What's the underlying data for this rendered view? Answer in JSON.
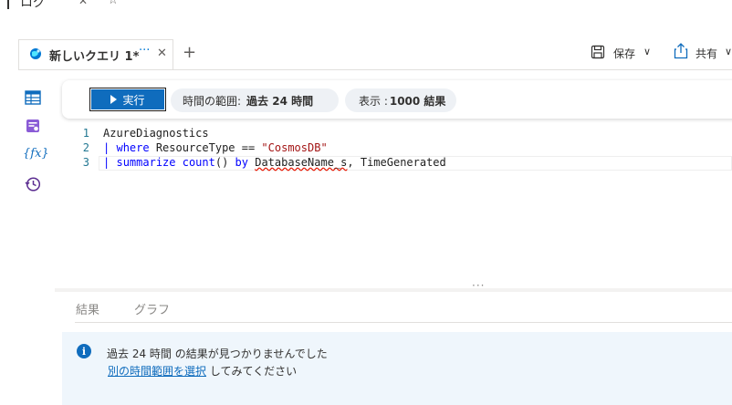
{
  "top": {
    "title": "ログ",
    "close_glyph": "✕",
    "star_glyph": "☆"
  },
  "tab": {
    "label": "新しいクエリ 1*",
    "ellipsis": "···",
    "close_glyph": "✕",
    "add_glyph": "+",
    "icon": "query-globe-icon"
  },
  "header_actions": {
    "save_label": "保存",
    "share_label": "共有",
    "chevron": "∨"
  },
  "sidebar": {
    "items": [
      {
        "name": "tables-icon"
      },
      {
        "name": "queries-icon"
      },
      {
        "name": "functions-icon",
        "glyph": "{fx}"
      },
      {
        "name": "history-icon"
      }
    ]
  },
  "toolbar": {
    "run_label": "実行",
    "time_range_label": "時間の範囲:",
    "time_range_value": "過去 24 時間",
    "show_label": "表示 :",
    "show_value": "1000 結果"
  },
  "editor": {
    "line_numbers": [
      "1",
      "2",
      "3"
    ],
    "line1": "AzureDiagnostics",
    "line2_pipe": "|",
    "line2_kw": "where",
    "line2_rest": " ResourceType == ",
    "line2_str": "\"CosmosDB\"",
    "line3_pipe": "|",
    "line3_kw1": "summarize",
    "line3_kw2": "count",
    "line3_mid": "() ",
    "line3_kw3": "by",
    "line3_squig": "DatabaseName_s",
    "line3_rest": ", TimeGenerated"
  },
  "splitter_glyph": "···",
  "results": {
    "tabs": [
      "結果",
      "グラフ"
    ],
    "message_line1": "過去 24 時間 の結果が見つかりませんでした",
    "message_link": "別の時間範囲を選択",
    "message_line2_rest": " してみてください",
    "info_glyph": "i"
  },
  "colors": {
    "accent": "#0f6cbd",
    "info_bg": "#eff6fc",
    "keyword": "#0000ff",
    "string": "#a31515"
  }
}
